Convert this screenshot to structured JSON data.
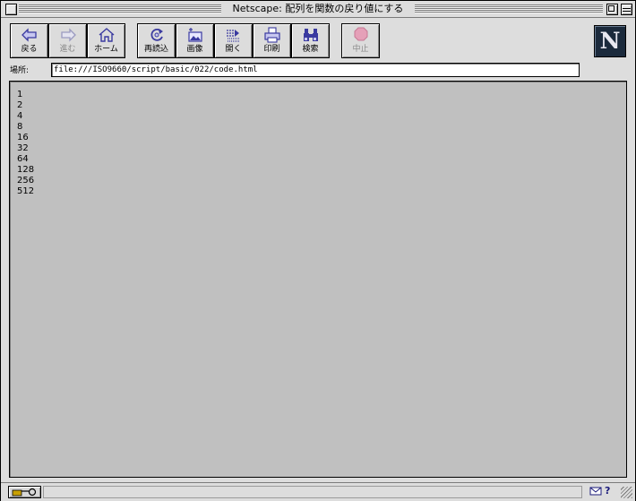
{
  "window": {
    "title": "Netscape: 配列を関数の戻り値にする"
  },
  "toolbar": {
    "back_label": "戻る",
    "forward_label": "進む",
    "home_label": "ホーム",
    "reload_label": "再読込",
    "images_label": "画像",
    "open_label": "開く",
    "print_label": "印刷",
    "find_label": "検索",
    "stop_label": "中止"
  },
  "logo": {
    "letter": "N"
  },
  "location": {
    "label": "場所:",
    "url": "file:///ISO9660/script/basic/022/code.html"
  },
  "content": {
    "lines": [
      "1",
      "2",
      "4",
      "8",
      "16",
      "32",
      "64",
      "128",
      "256",
      "512"
    ]
  },
  "status": {
    "message": ""
  },
  "colors": {
    "chrome": "#dddddd",
    "content_bg": "#c0c0c0",
    "icon_accent": "#3a3aa0",
    "stop_disabled": "#e5a0b8",
    "logo_bg": "#1b2a3c"
  }
}
